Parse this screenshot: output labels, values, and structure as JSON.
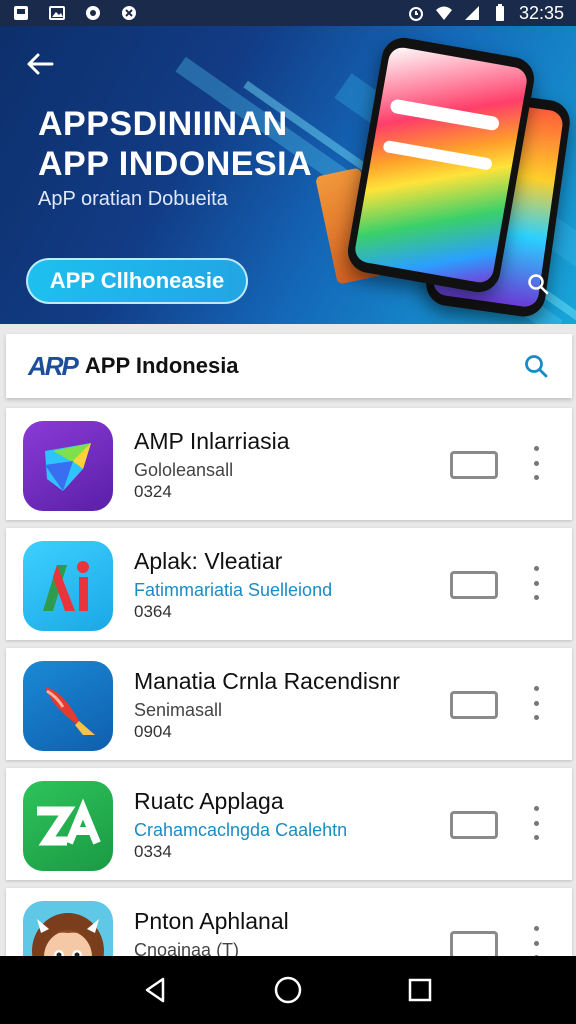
{
  "status_bar": {
    "time": "32:35",
    "icons": [
      "photo-icon",
      "image-icon",
      "circle-icon",
      "shield-icon",
      "alarm-icon",
      "wifi-icon",
      "signal-icon",
      "battery-icon"
    ]
  },
  "hero": {
    "title_line1": "APPSDINIINAN",
    "title_line2": "APP  INDONESIA",
    "subtitle": "ApP oratian Dobueita",
    "cta_label": "APP Cllhoneasie",
    "colors": {
      "bg_start": "#0d2f6b",
      "bg_end": "#17a6d9",
      "cta": "#1ec0ef"
    }
  },
  "header": {
    "logo_text": "ARP",
    "brand_name": "APP Indonesia"
  },
  "apps": [
    {
      "title": "AMP Inlarriasia",
      "subtitle": "Gololeansall",
      "number": "0324",
      "subtitle_link": false,
      "icon": "colorful-shape-icon"
    },
    {
      "title": "Aplak: Vleatiar",
      "subtitle": "Fatimmariatia Suelleiond",
      "number": "0364",
      "subtitle_link": true,
      "icon": "ai-logo-icon"
    },
    {
      "title": "Manatia Crnla Racendisnr",
      "subtitle": "Senimasall",
      "number": "0904",
      "subtitle_link": false,
      "icon": "brush-icon"
    },
    {
      "title": "Ruatc Applaga",
      "subtitle": "Crahamcaclngda Caalehtn",
      "number": "0334",
      "subtitle_link": true,
      "icon": "za-logo-icon"
    },
    {
      "title": "Pnton Aphlanal",
      "subtitle": "Cnoainaa (T)",
      "number": "",
      "subtitle_link": false,
      "icon": "cartoon-face-icon"
    }
  ]
}
